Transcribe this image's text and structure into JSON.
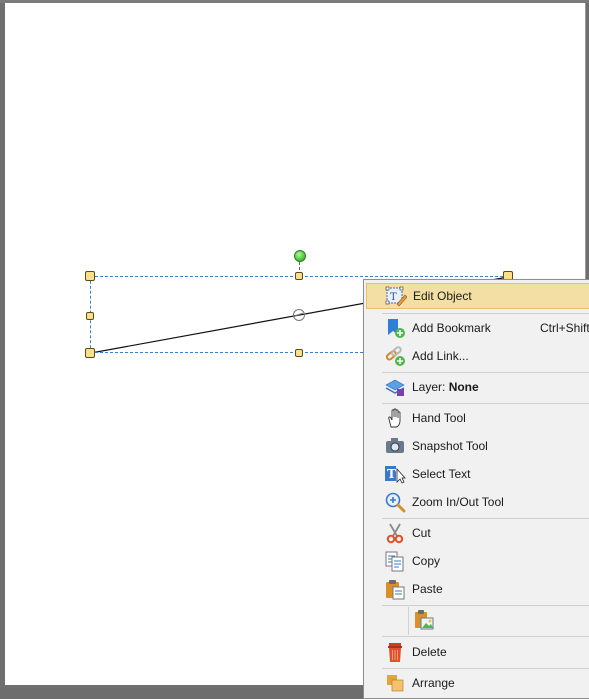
{
  "colors": {
    "selection_border": "#3a7fd4",
    "handle_fill": "#fbe08a",
    "rotate_handle": "#3cc02b",
    "menu_highlight": "#f3dfa3",
    "menu_bg": "#f1f1f1"
  },
  "context_menu": {
    "items": [
      {
        "label": "Edit Object",
        "icon": "edit-object-icon",
        "highlighted": true
      },
      {
        "label": "Add Bookmark",
        "shortcut": "Ctrl+Shift",
        "icon": "add-bookmark-icon"
      },
      {
        "label": "Add Link...",
        "icon": "add-link-icon"
      },
      {
        "label_prefix": "Layer: ",
        "label_value": "None",
        "icon": "layer-icon"
      },
      {
        "label": "Hand Tool",
        "icon": "hand-icon"
      },
      {
        "label": "Snapshot Tool",
        "icon": "camera-icon"
      },
      {
        "label": "Select Text",
        "icon": "select-text-icon"
      },
      {
        "label": "Zoom In/Out Tool",
        "icon": "zoom-icon"
      },
      {
        "label": "Cut",
        "icon": "scissors-icon"
      },
      {
        "label": "Copy",
        "icon": "copy-icon"
      },
      {
        "label": "Paste",
        "icon": "paste-icon"
      },
      {
        "label": "",
        "icon": "paste-image-icon"
      },
      {
        "label": "Delete",
        "icon": "trash-icon"
      },
      {
        "label": "Arrange",
        "icon": "arrange-icon"
      }
    ]
  }
}
